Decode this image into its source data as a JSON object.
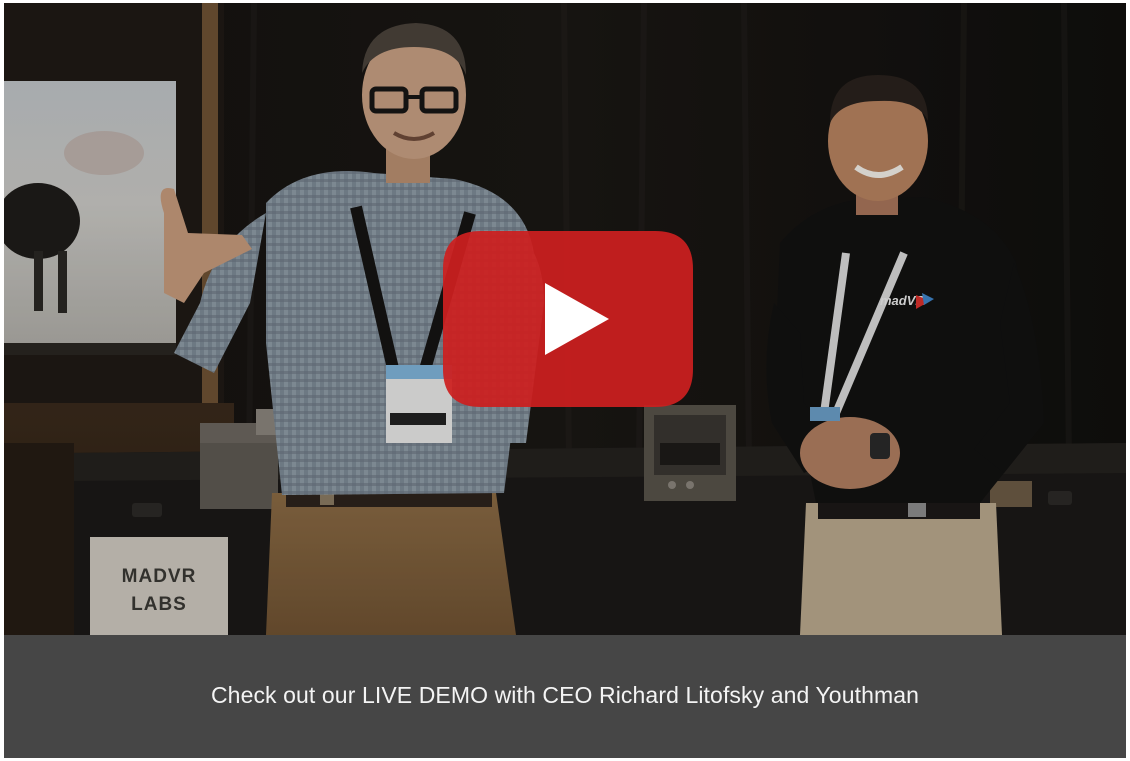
{
  "video": {
    "sign_line1": "MADVR",
    "sign_line2": "LABS",
    "shirt_logo": "madVR",
    "play_icon": "youtube-play-icon",
    "play_color": "#cc1f1f"
  },
  "caption": {
    "text": "Check out our LIVE DEMO with CEO Richard Litofsky and Youthman",
    "background": "#464646"
  }
}
